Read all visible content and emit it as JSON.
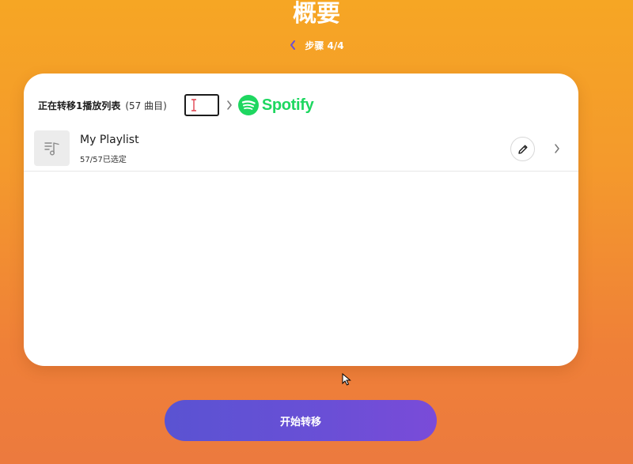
{
  "header": {
    "title": "概要",
    "step_text": "步骤 4/4"
  },
  "card": {
    "transfer_label": "正在转移1播放列表",
    "track_count": "(57 曲目)",
    "destination": "Spotify",
    "playlist": {
      "name": "My Playlist",
      "selected_text": "57/57已选定"
    }
  },
  "actions": {
    "start_label": "开始转移"
  },
  "icons": {
    "back": "chevron-left-icon",
    "separator": "chevron-right-icon",
    "thumbnail": "music-note-icon",
    "edit": "pencil-icon",
    "open": "chevron-right-icon",
    "text_cursor": "text-cursor-icon",
    "mouse": "mouse-pointer-icon"
  },
  "colors": {
    "background_top": "#f6a624",
    "background_bottom": "#ec7a3e",
    "spotify_green": "#1ed760",
    "button_start": "#5a53d2",
    "button_end": "#7a4bd8",
    "back_chevron": "#6a4fd6"
  }
}
